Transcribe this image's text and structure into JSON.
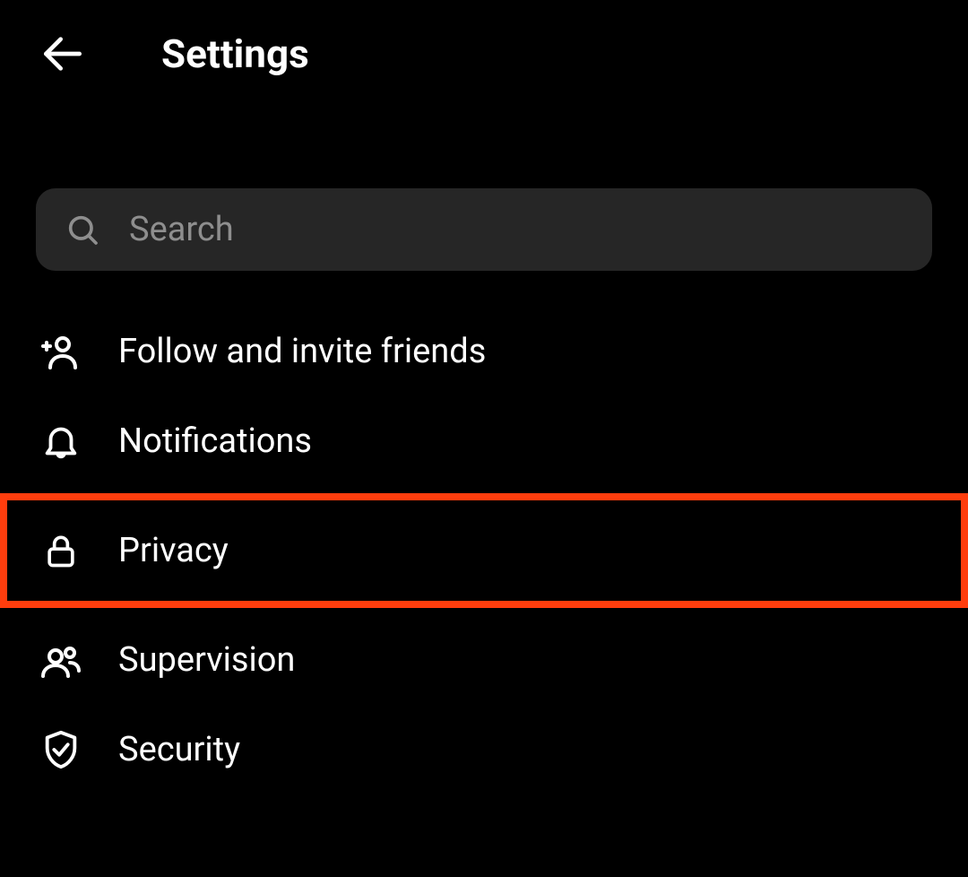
{
  "header": {
    "title": "Settings"
  },
  "search": {
    "placeholder": "Search"
  },
  "menu": {
    "items": [
      {
        "label": "Follow and invite friends",
        "icon": "person-add-icon",
        "highlighted": false
      },
      {
        "label": "Notifications",
        "icon": "bell-icon",
        "highlighted": false
      },
      {
        "label": "Privacy",
        "icon": "lock-icon",
        "highlighted": true
      },
      {
        "label": "Supervision",
        "icon": "people-icon",
        "highlighted": false
      },
      {
        "label": "Security",
        "icon": "shield-check-icon",
        "highlighted": false
      }
    ]
  }
}
